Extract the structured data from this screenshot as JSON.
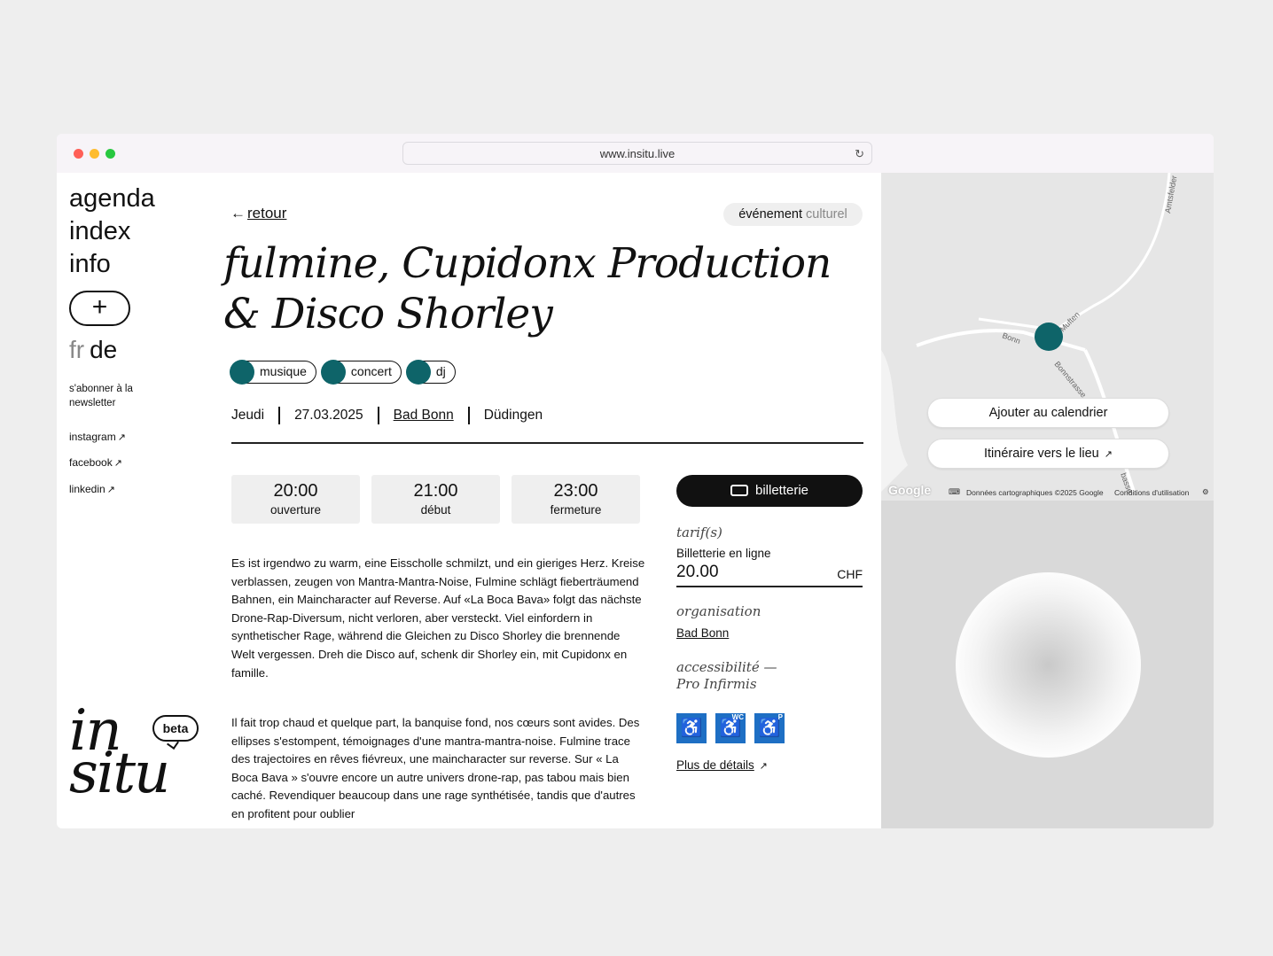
{
  "browser": {
    "url": "www.insitu.live",
    "reload_icon": "reload-icon"
  },
  "sidebar": {
    "nav": [
      {
        "label": "agenda"
      },
      {
        "label": "index"
      },
      {
        "label": "info"
      }
    ],
    "add_icon": "+",
    "lang": {
      "fr": "fr",
      "de": "de"
    },
    "newsletter": "s'abonner à la newsletter",
    "social": [
      {
        "label": "instagram"
      },
      {
        "label": "facebook"
      },
      {
        "label": "linkedin"
      }
    ],
    "logo": {
      "line1": "in",
      "line2": "situ",
      "badge": "beta"
    }
  },
  "event": {
    "back_label": "retour",
    "type_badge": {
      "main": "événement",
      "sub": "culturel"
    },
    "title": "fulmine, Cupidonx Production & Disco Shorley",
    "tags": [
      {
        "label": "musique"
      },
      {
        "label": "concert"
      },
      {
        "label": "dj"
      }
    ],
    "day": "Jeudi",
    "date": "27.03.2025",
    "venue": "Bad Bonn",
    "city": "Düdingen",
    "times": [
      {
        "time": "20:00",
        "label": "ouverture"
      },
      {
        "time": "21:00",
        "label": "début"
      },
      {
        "time": "23:00",
        "label": "fermeture"
      }
    ],
    "description_de": "Es ist irgendwo zu warm, eine Eisscholle schmilzt, und ein gieriges Herz. Kreise verblassen, zeugen von Mantra-Mantra-Noise, Fulmine schlägt fieberträumend Bahnen, ein Maincharacter auf Reverse. Auf «La Boca Bava» folgt das nächste Drone-Rap-Diversum, nicht verloren, aber versteckt. Viel einfordern in synthetischer Rage, während die Gleichen zu Disco Shorley die brennende Welt vergessen. Dreh die Disco auf, schenk dir Shorley ein, mit Cupidonx en famille.",
    "description_fr": "Il fait trop chaud et quelque part, la banquise fond, nos cœurs sont avides. Des ellipses s'estompent, témoignages d'une mantra-mantra-noise. Fulmine trace des trajectoires en rêves fiévreux, une maincharacter sur reverse. Sur « La Boca Bava » s'ouvre encore un autre univers drone-rap, pas tabou mais bien caché. Revendiquer beaucoup dans une rage synthétisée, tandis que d'autres en profitent pour oublier"
  },
  "ticketing": {
    "button_label": "billetterie",
    "tarif_label": "tarif(s)",
    "price_label": "Billetterie en ligne",
    "price_value": "20.00",
    "currency": "CHF",
    "organisation_label": "organisation",
    "organisation": "Bad Bonn",
    "accessibility_label": "accessibilité —",
    "accessibility_org": "Pro Infirmis",
    "accessibility_icons": [
      {
        "name": "wheelchair-icon",
        "badge": ""
      },
      {
        "name": "wheelchair-wc-icon",
        "badge": "WC"
      },
      {
        "name": "wheelchair-parking-icon",
        "badge": "P"
      }
    ],
    "details_label": "Plus de détails"
  },
  "map": {
    "add_calendar": "Ajouter au calendrier",
    "directions": "Itinéraire vers le lieu",
    "streets": {
      "bonn": "Bonn",
      "bonnstrasse": "Bonnstrasse",
      "muften": "Muften",
      "amtsfelder": "Amtsfelder",
      "basse": "basse"
    },
    "google": "Google",
    "data": "Données cartographiques ©2025 Google",
    "terms": "Conditions d'utilisation",
    "settings_icon": "⚙",
    "keyboard_icon": "⌨"
  },
  "colors": {
    "accent": "#0e6469",
    "accessibility_blue": "#1e6fc4",
    "window_bg": "#ffffff",
    "page_bg": "#eeeeee"
  }
}
